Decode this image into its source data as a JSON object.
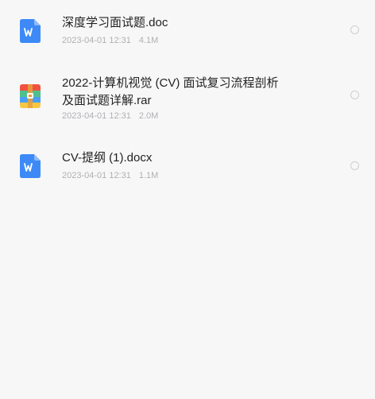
{
  "files": [
    {
      "type": "word",
      "icon": "word-doc-icon",
      "name": "深度学习面试题.doc",
      "date": "2023-04-01 12:31",
      "size": "4.1M",
      "selected": false
    },
    {
      "type": "archive",
      "icon": "archive-rar-icon",
      "name": "2022-计算机视觉 (CV) 面试复习流程剖析\n及面试题详解.rar",
      "date": "2023-04-01 12:31",
      "size": "2.0M",
      "selected": false
    },
    {
      "type": "word",
      "icon": "word-doc-icon",
      "name": "CV-提纲 (1).docx",
      "date": "2023-04-01 12:31",
      "size": "1.1M",
      "selected": false
    }
  ],
  "colors": {
    "word_blue": "#3d8af7",
    "archive_red": "#f0523f",
    "archive_green": "#4fc08d",
    "archive_blue": "#4a9ff5",
    "archive_yellow": "#f7c744",
    "background": "#f7f7f8"
  }
}
